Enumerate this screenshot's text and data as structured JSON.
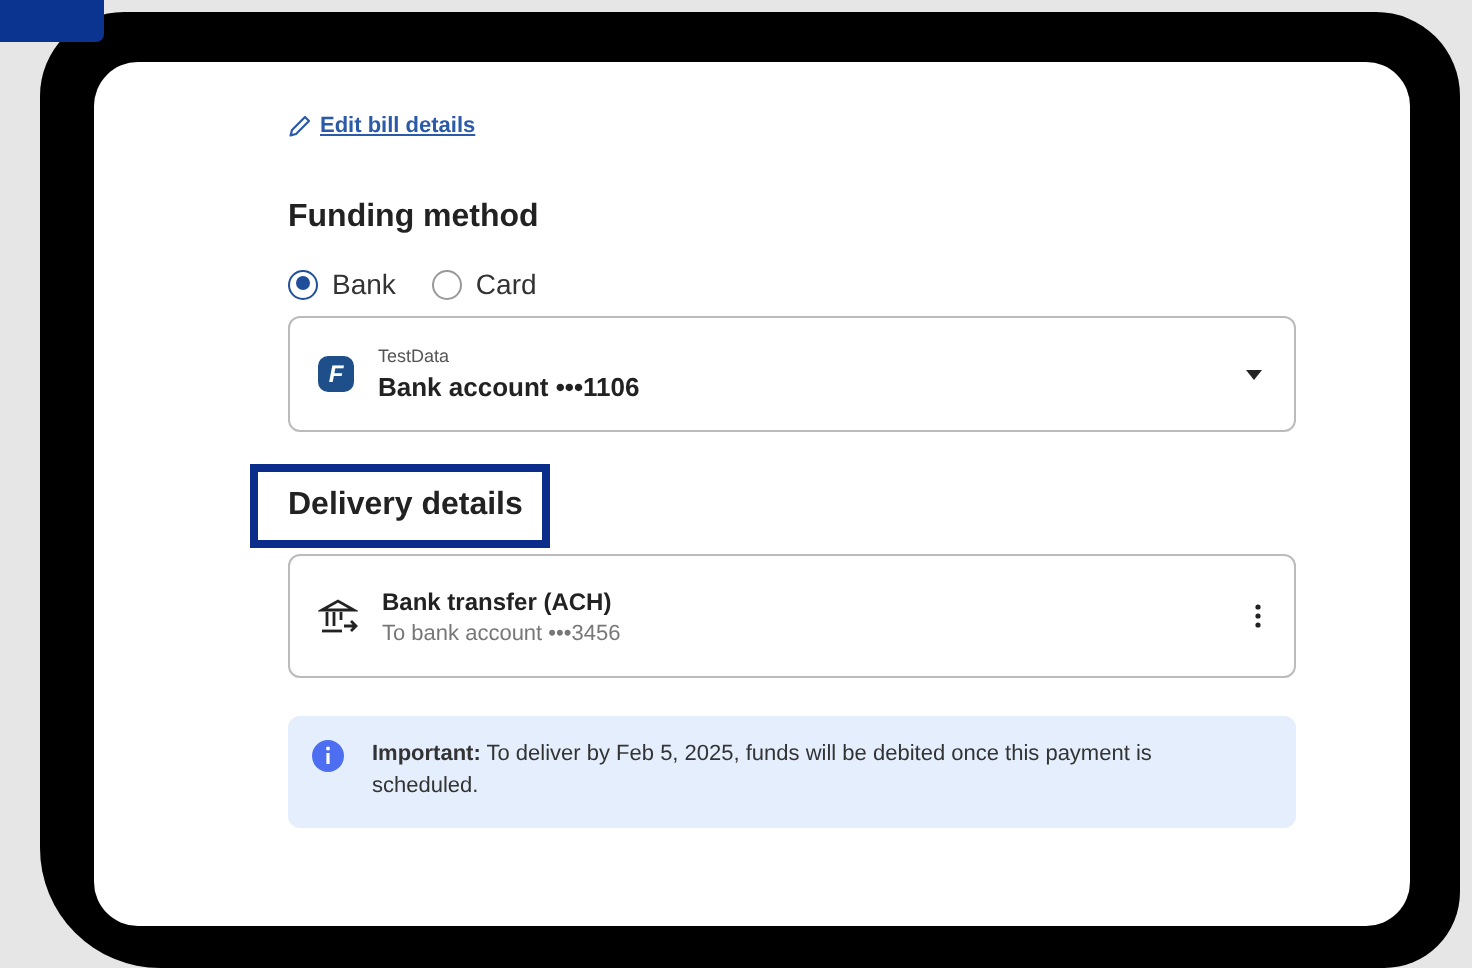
{
  "edit_link": "Edit bill details",
  "funding": {
    "title": "Funding method",
    "options": [
      {
        "label": "Bank",
        "selected": true
      },
      {
        "label": "Card",
        "selected": false
      }
    ],
    "account": {
      "logo": "F",
      "provider": "TestData",
      "name": "Bank account •••1106"
    }
  },
  "delivery": {
    "title": "Delivery details",
    "highlighted": true,
    "method": {
      "name": "Bank transfer (ACH)",
      "detail": "To bank account •••3456"
    }
  },
  "notice": {
    "text": "**Important:** To deliver by Feb 5, 2025, funds will be debited once this payment is scheduled."
  }
}
